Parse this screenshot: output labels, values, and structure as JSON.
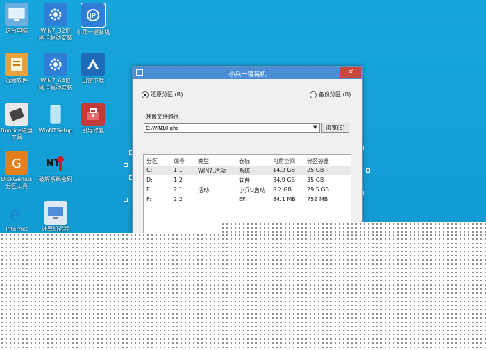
{
  "desktop_icons": [
    {
      "label": "这台电脑",
      "icon": "computer-icon",
      "color": "#6aaee0"
    },
    {
      "label": "WIN7_32位\n网卡驱动安装",
      "icon": "driver-gear-icon",
      "color": "#2f7fd6"
    },
    {
      "label": "小兵一键装机",
      "icon": "installer-icon",
      "color": "#2f7fd6"
    },
    {
      "label": "远程软件",
      "icon": "remote-software-icon",
      "color": "#e9a23b"
    },
    {
      "label": "WIN7_64位\n网卡驱动安装",
      "icon": "driver-gear-icon",
      "color": "#2f7fd6"
    },
    {
      "label": "迅雷下载",
      "icon": "thunder-icon",
      "color": "#1e6bb8"
    },
    {
      "label": "Bootice磁盘\n工具",
      "icon": "bootice-icon",
      "color": "#555555"
    },
    {
      "label": "WinNTSetup",
      "icon": "winntsetup-icon",
      "color": "#7ecbe8"
    },
    {
      "label": "引导修复",
      "icon": "boot-repair-icon",
      "color": "#c23b3b"
    },
    {
      "label": "DiskGenius\n分区工具",
      "icon": "diskgenius-icon",
      "color": "#e57f1c"
    },
    {
      "label": "破解系统密码",
      "icon": "password-crack-icon",
      "color": "#cc2020"
    },
    {
      "label": "Internet",
      "icon": "ie-icon",
      "color": "#1b7fd1"
    },
    {
      "label": "计算机远程",
      "icon": "remote-desktop-icon",
      "color": "#4f8fd9"
    }
  ],
  "window": {
    "title": "小兵一键装机",
    "close": "✕",
    "restore_label": "还原分区 (R)",
    "backup_label": "备份分区 (B)",
    "image_path_label": "映像文件路径",
    "image_path_value": "E:\\WIN10.gho",
    "browse_label": "浏览(S)"
  },
  "table": {
    "headers": [
      "分区",
      "编号",
      "类型",
      "卷标",
      "可用空间",
      "分区容量"
    ],
    "rows": [
      [
        "C:",
        "1:1",
        "WIN7,活动",
        "系统",
        "14.2 GB",
        "25 GB"
      ],
      [
        "D:",
        "1:2",
        "",
        "软件",
        "34.9 GB",
        "35 GB"
      ],
      [
        "E:",
        "2:1",
        "活动",
        "小兵U启动",
        "8.2 GB",
        "29.5 GB"
      ],
      [
        "F:",
        "2:2",
        "",
        "EFI",
        "84.1 MB",
        "752 MB"
      ]
    ]
  }
}
